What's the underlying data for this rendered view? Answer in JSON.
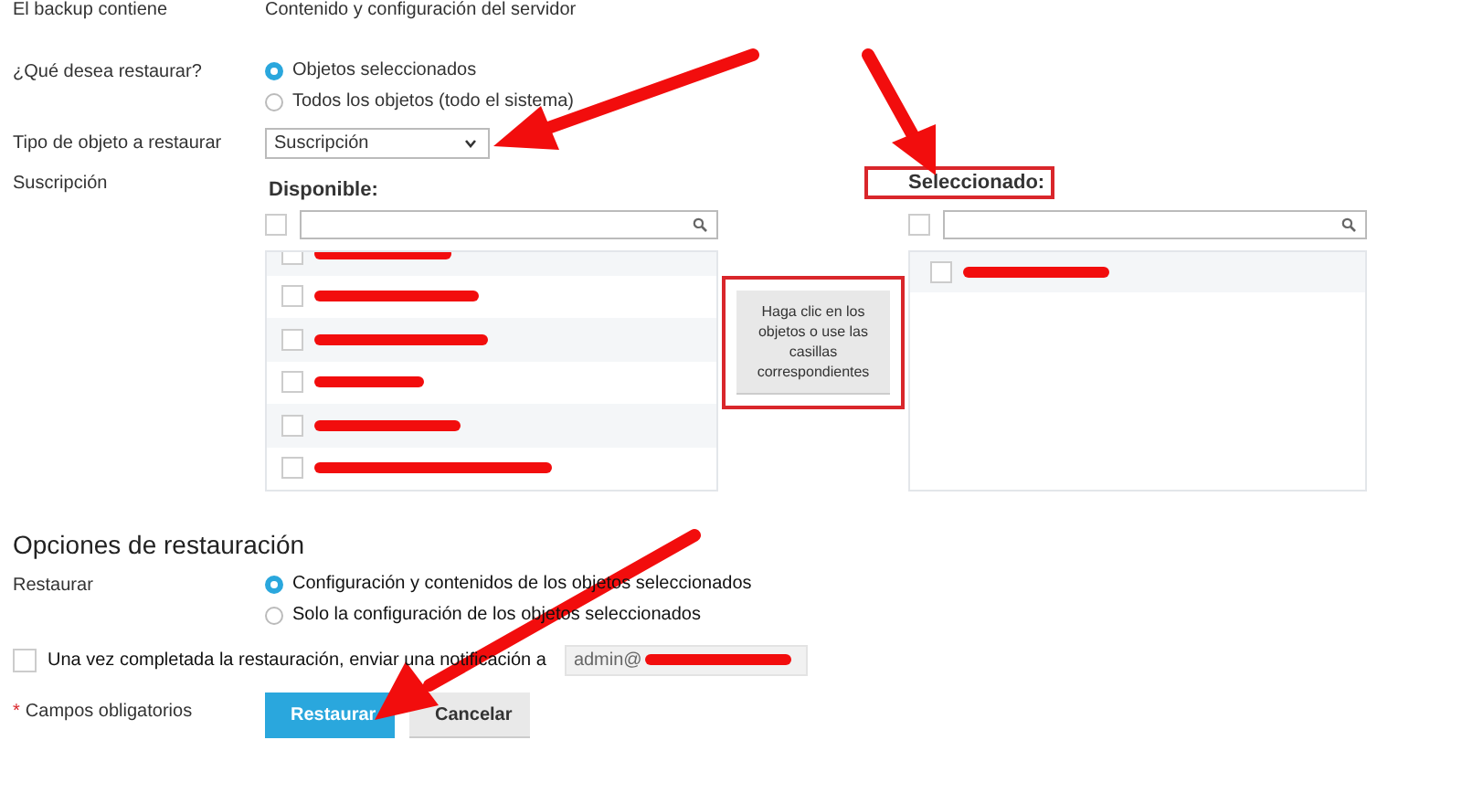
{
  "backup_contains": {
    "label": "El backup contiene",
    "value": "Contenido y configuración del servidor"
  },
  "restore_what": {
    "label": "¿Qué desea restaurar?",
    "options": [
      {
        "label": "Objetos seleccionados",
        "selected": true
      },
      {
        "label": "Todos los objetos (todo el sistema)",
        "selected": false
      }
    ]
  },
  "object_type": {
    "label": "Tipo de objeto a restaurar",
    "value": "Suscripción"
  },
  "subscription": {
    "label": "Suscripción",
    "available": {
      "title": "Disponible:",
      "highlighted": false,
      "all_checked": false,
      "items": [
        {
          "checked": false
        },
        {
          "checked": false
        },
        {
          "checked": false
        },
        {
          "checked": false
        },
        {
          "checked": false
        },
        {
          "checked": false
        }
      ]
    },
    "hint_button": {
      "label": "Haga clic en los objetos o use las casillas correspondientes",
      "highlighted": true
    },
    "selected": {
      "title": "Seleccionado:",
      "highlighted": true,
      "all_checked": false,
      "items": [
        {
          "checked": false
        }
      ]
    }
  },
  "restore_options": {
    "heading": "Opciones de restauración",
    "label": "Restaurar",
    "options": [
      {
        "label": "Configuración y contenidos de los objetos seleccionados",
        "selected": true
      },
      {
        "label": "Solo la configuración de los objetos seleccionados",
        "selected": false
      }
    ]
  },
  "notify": {
    "checked": false,
    "label": "Una vez completada la restauración, enviar una notificación a",
    "value": "admin@"
  },
  "required": {
    "mark": "*",
    "label": "Campos obligatorios"
  },
  "buttons": [
    {
      "label": "Restaurar",
      "kind": "primary"
    },
    {
      "label": "Cancelar",
      "kind": "secondary"
    }
  ]
}
